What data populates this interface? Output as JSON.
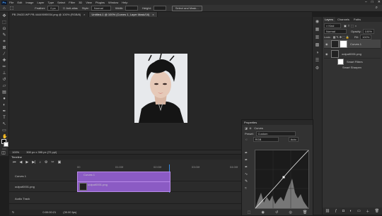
{
  "menubar": {
    "app_badge": "Ps",
    "items": [
      "File",
      "Edit",
      "Image",
      "Layer",
      "Type",
      "Select",
      "Filter",
      "3D",
      "View",
      "Plugins",
      "Window",
      "Help"
    ],
    "window_controls": [
      "–",
      "□",
      "✕"
    ]
  },
  "options": {
    "feather_label": "Feather:",
    "feather_value": "0 px",
    "antialias_label": "Anti-alias",
    "style_label": "Style:",
    "style_value": "Normal",
    "width_label": "Width:",
    "height_label": "Height:",
    "select_mask_label": "Select and Mask..."
  },
  "tabs": [
    {
      "label": "PB 29433 WP PB 44449095934.png @ 100% (RGB/8)"
    },
    {
      "label": "Untitled-1 @ 100% (Curves 1, Layer Mask/16)"
    }
  ],
  "status": {
    "zoom": "100%",
    "doc_info": "300 px x 395 px (72 ppi)"
  },
  "layers_panel": {
    "tabs": [
      "Layers",
      "Channels",
      "Paths"
    ],
    "kind_label": "Kind",
    "blend_mode": "Normal",
    "opacity_label": "Opacity:",
    "opacity_value": "100%",
    "lock_label": "Lock:",
    "fill_label": "Fill:",
    "fill_value": "100%",
    "layers": [
      {
        "name": "Curves 1"
      },
      {
        "name": "output0001.png"
      }
    ],
    "sublayers": [
      "Smart Filters",
      "Smart Sharpen"
    ]
  },
  "timeline": {
    "title": "Timeline",
    "ruler": [
      "00",
      "01:00f",
      "02:00f",
      "03:00f",
      "04:00f",
      "05:00f",
      "06"
    ],
    "tracks": [
      {
        "name": "Curves 1",
        "clip_label": "Curves 1"
      },
      {
        "name": "output0001.png",
        "clip_label": "output0001.png"
      }
    ],
    "audio_label": "Audio Track",
    "timecode": "0:00:00:21",
    "fps": "(30.00 fps)"
  },
  "properties": {
    "title": "Properties",
    "section": "Curves",
    "preset_label": "Preset:",
    "preset_value": "Custom",
    "channel_value": "RGB",
    "auto_label": "Auto"
  },
  "colors": {
    "accent": "#3a8ee6",
    "clip": "#8b5bc4"
  }
}
